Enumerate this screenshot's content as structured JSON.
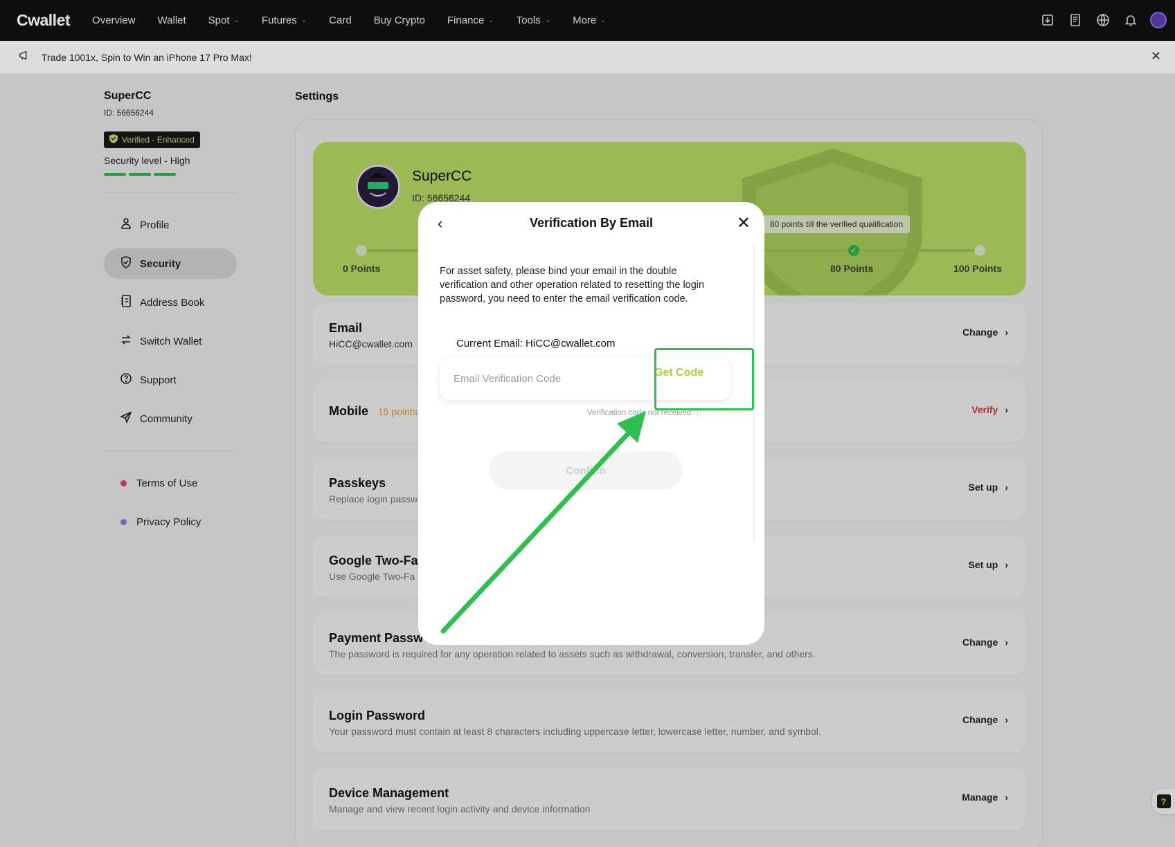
{
  "nav": {
    "logo": "Cwallet",
    "items": [
      {
        "label": "Overview",
        "dropdown": false
      },
      {
        "label": "Wallet",
        "dropdown": false
      },
      {
        "label": "Spot",
        "dropdown": true
      },
      {
        "label": "Futures",
        "dropdown": true
      },
      {
        "label": "Card",
        "dropdown": false
      },
      {
        "label": "Buy Crypto",
        "dropdown": false
      },
      {
        "label": "Finance",
        "dropdown": true
      },
      {
        "label": "Tools",
        "dropdown": true
      },
      {
        "label": "More",
        "dropdown": true
      }
    ],
    "icons": [
      "download-icon",
      "orders-icon",
      "globe-icon",
      "bell-icon",
      "avatar"
    ]
  },
  "announcement": {
    "text": "Trade 1001x, Spin to Win an iPhone 17 Pro Max!"
  },
  "sidebar": {
    "name": "SuperCC",
    "id": "ID: 56656244",
    "badge": "Verified - Enhanced",
    "security_level": "Security level - High",
    "menu": [
      {
        "label": "Profile",
        "icon": "profile-icon",
        "active": false
      },
      {
        "label": "Security",
        "icon": "shield-icon",
        "active": true
      },
      {
        "label": "Address Book",
        "icon": "address-book-icon",
        "active": false
      },
      {
        "label": "Switch Wallet",
        "icon": "switch-icon",
        "active": false
      },
      {
        "label": "Support",
        "icon": "help-circle-icon",
        "active": false
      },
      {
        "label": "Community",
        "icon": "send-icon",
        "active": false
      }
    ],
    "legal": [
      {
        "label": "Terms of Use",
        "color": "#e0457b"
      },
      {
        "label": "Privacy Policy",
        "color": "#8a7be0"
      }
    ]
  },
  "main": {
    "title": "Settings",
    "hero": {
      "name": "SuperCC",
      "id": "ID: 56656244",
      "tooltip": "80 points till the verified qualification",
      "points": [
        "0 Points",
        "80 Points",
        "100 Points"
      ]
    },
    "rows": [
      {
        "title": "Email",
        "sub": "HiCC@cwallet.com",
        "action": "Change"
      },
      {
        "title": "Mobile",
        "points": "15 points",
        "action": "Verify"
      },
      {
        "title": "Passkeys",
        "sub": "Replace login passw",
        "action": "Set up"
      },
      {
        "title": "Google Two-Fa",
        "sub": "Use Google Two-Fa",
        "action": "Set up"
      },
      {
        "title": "Payment Passw",
        "sub": "The password is required for any operation related to assets such as withdrawal, conversion, transfer, and others.",
        "action": "Change"
      },
      {
        "title": "Login Password",
        "sub": "Your password must contain at least 8 characters including uppercase letter, lowercase letter, number, and symbol.",
        "action": "Change"
      },
      {
        "title": "Device Management",
        "sub": "Manage and view recent login activity and device information",
        "action": "Manage"
      }
    ]
  },
  "modal": {
    "title": "Verification By Email",
    "description": "For asset safety, please bind your email in the double verification and other operation related to resetting the login password, you need to enter the email verification code.",
    "current_email": "Current Email: HiCC@cwallet.com",
    "input_placeholder": "Email Verification Code",
    "input_value": "",
    "get_code": "Get Code",
    "resend": "Verification code not received",
    "confirm": "Confirm"
  },
  "colors": {
    "accent_green": "#2fbf4f",
    "hero_bg": "#bde36a",
    "get_code": "#a6d13d",
    "verify_red": "#d63838"
  }
}
